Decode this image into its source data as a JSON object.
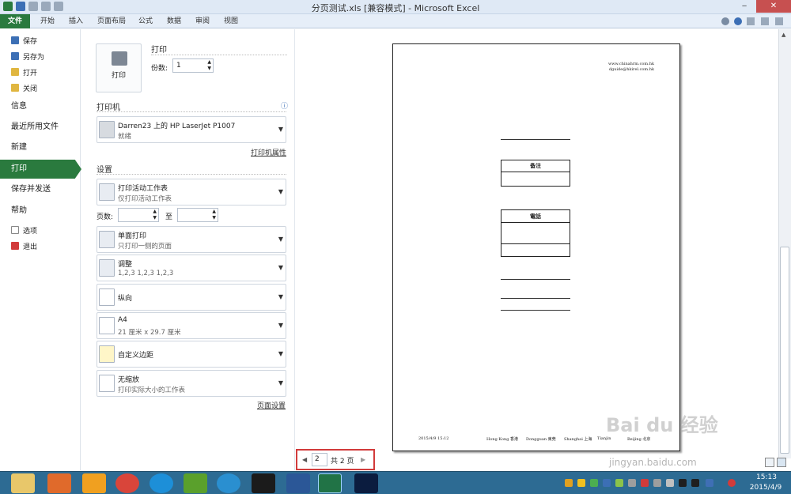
{
  "titlebar": {
    "title": "分页测试.xls [兼容模式] - Microsoft Excel",
    "minimize": "‒",
    "restore": "❐",
    "close": "✕"
  },
  "ribbon_tabs": [
    "文件",
    "开始",
    "插入",
    "页面布局",
    "公式",
    "数据",
    "审阅",
    "视图"
  ],
  "nav": {
    "save": "保存",
    "save_as": "另存为",
    "open": "打开",
    "close": "关闭",
    "info": "信息",
    "recent": "最近所用文件",
    "new": "新建",
    "print": "打印",
    "save_send": "保存并发送",
    "help": "帮助",
    "options": "选项",
    "exit": "退出"
  },
  "print": {
    "title": "打印",
    "button_label": "打印",
    "copies_label": "份数:",
    "copies_value": "1"
  },
  "printer": {
    "section": "打印机",
    "name": "Darren23 上的 HP LaserJet P1007",
    "status": "就绪",
    "properties_link": "打印机属性",
    "info_icon": "ⓘ"
  },
  "settings": {
    "section": "设置",
    "what": {
      "main": "打印活动工作表",
      "sub": "仅打印活动工作表"
    },
    "pages_label": "页数:",
    "to_label": "至",
    "sides": {
      "main": "单面打印",
      "sub": "只打印一侧的页面"
    },
    "collate": {
      "main": "调整",
      "sub": "1,2,3    1,2,3    1,2,3"
    },
    "orientation": {
      "main": "纵向"
    },
    "paper": {
      "main": "A4",
      "sub": "21 厘米 x 29.7 厘米"
    },
    "margins": {
      "main": "自定义边距"
    },
    "scaling": {
      "main": "无缩放",
      "sub": "打印实际大小的工作表"
    },
    "page_setup_link": "页面设置"
  },
  "preview": {
    "header_right_1": "www.chinahrm.com.hk",
    "header_right_2": "dguide@hkirel.com.hk",
    "table1_header": "备注",
    "table2_header": "電話",
    "footer": {
      "date": "2015/4/9 15:12",
      "col1": "Hong Kong 香港",
      "col2": "Dongguan 東莞",
      "col3": "Shanghai 上海",
      "col4": "Tianjin",
      "col5": "Beijing 北京"
    }
  },
  "pagenav": {
    "current": "2",
    "total": "共 2 页"
  },
  "taskbar": {
    "time": "15:13",
    "date": "2015/4/9"
  },
  "watermark": {
    "brand": "Bai du 经验",
    "url": "jingyan.baidu.com"
  },
  "colors": {
    "file_green": "#2a7a3e",
    "highlight_red": "#d23b3b",
    "taskbar_blue": "#2d6b93"
  }
}
